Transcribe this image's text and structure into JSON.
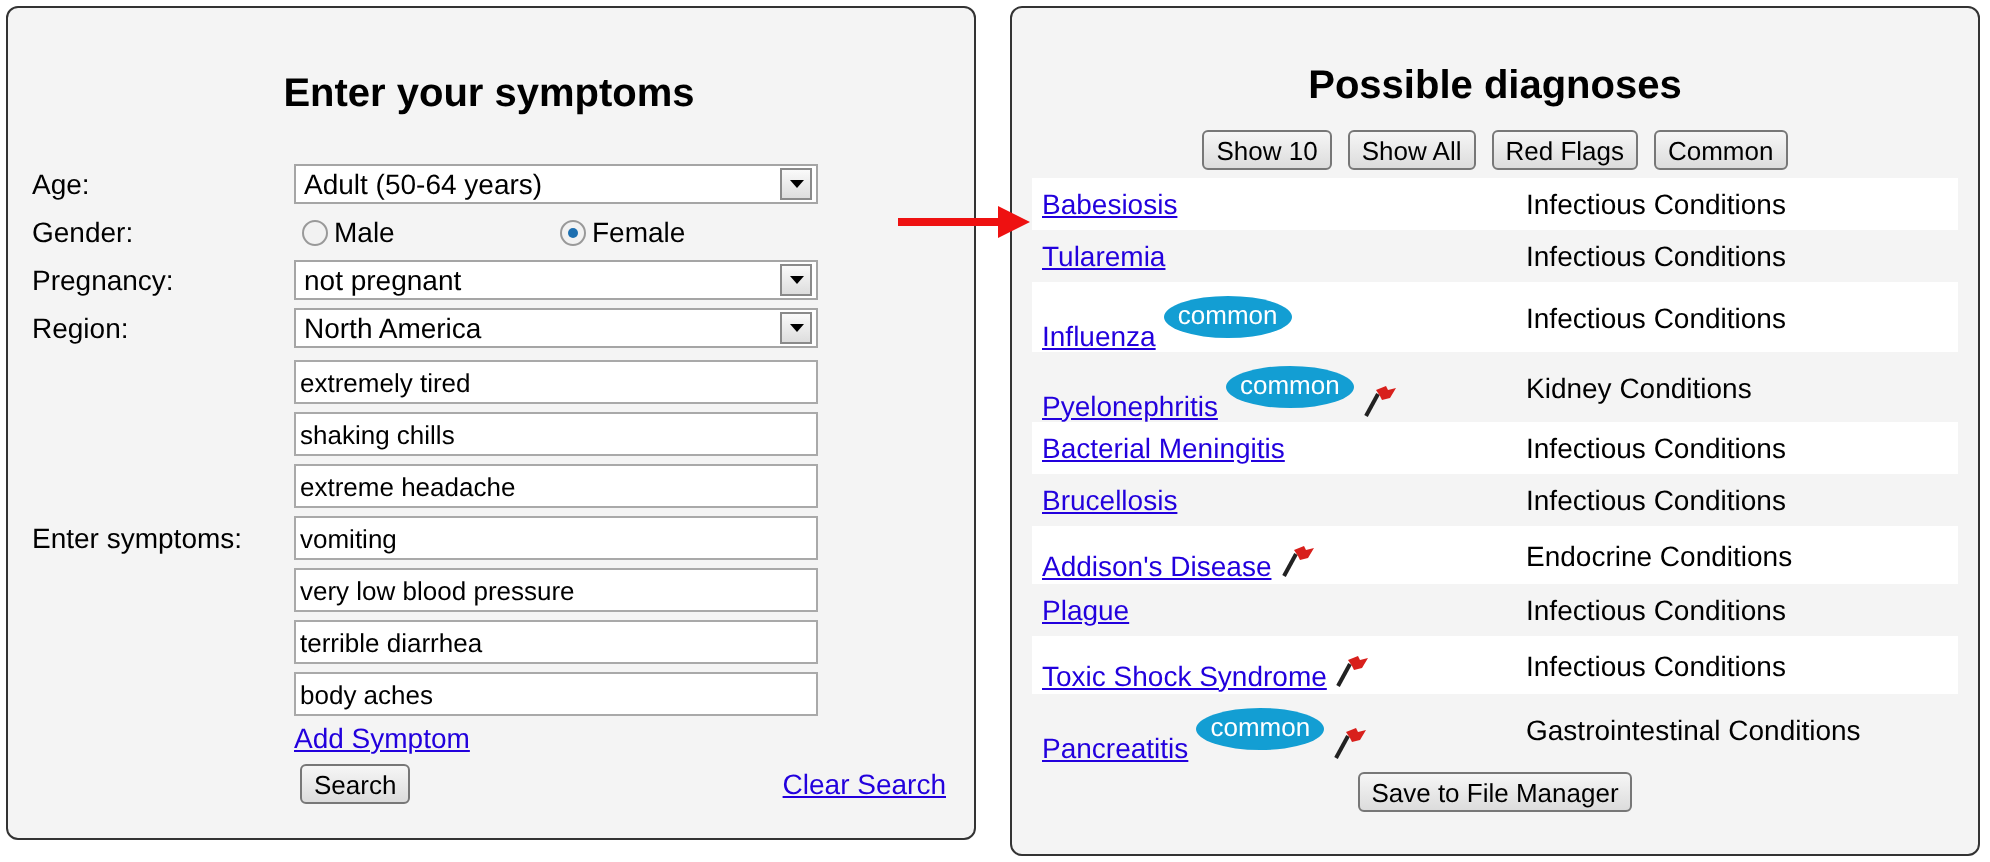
{
  "symptoms_panel": {
    "title": "Enter your symptoms",
    "age": {
      "label": "Age:",
      "value": "Adult (50-64 years)"
    },
    "gender": {
      "label": "Gender:",
      "options": [
        {
          "label": "Male",
          "selected": false
        },
        {
          "label": "Female",
          "selected": true
        }
      ]
    },
    "pregnancy": {
      "label": "Pregnancy:",
      "value": "not pregnant"
    },
    "region": {
      "label": "Region:",
      "value": "North America"
    },
    "symptoms_label": "Enter symptoms:",
    "symptoms": [
      "extremely tired",
      "shaking chills",
      "extreme headache",
      "vomiting",
      "very low blood pressure",
      "terrible diarrhea",
      "body aches"
    ],
    "add_link": "Add Symptom",
    "search_button": "Search",
    "clear_link": "Clear Search"
  },
  "diagnoses_panel": {
    "title": "Possible diagnoses",
    "filters": [
      "Show 10",
      "Show All",
      "Red Flags",
      "Common"
    ],
    "rows": [
      {
        "name": "Babesiosis",
        "category": "Infectious Conditions",
        "red_flag": false
      },
      {
        "name": "Tularemia",
        "category": "Infectious Conditions",
        "red_flag": false
      },
      {
        "name": "Influenza",
        "badge": "common",
        "category": "Infectious Conditions",
        "red_flag": false
      },
      {
        "name": "Pyelonephritis",
        "badge": "common",
        "category": "Kidney Conditions",
        "red_flag": true
      },
      {
        "name": "Bacterial Meningitis",
        "category": "Infectious Conditions",
        "red_flag": false
      },
      {
        "name": "Brucellosis",
        "category": "Infectious Conditions",
        "red_flag": false
      },
      {
        "name": "Addison's Disease",
        "category": "Endocrine Conditions",
        "red_flag": true
      },
      {
        "name": "Plague",
        "category": "Infectious Conditions",
        "red_flag": false
      },
      {
        "name": "Toxic Shock Syndrome",
        "category": "Infectious Conditions",
        "red_flag": true
      },
      {
        "name": "Pancreatitis",
        "badge": "common",
        "category": "Gastrointestinal Conditions",
        "red_flag": true
      }
    ],
    "save_button": "Save to File Manager"
  }
}
